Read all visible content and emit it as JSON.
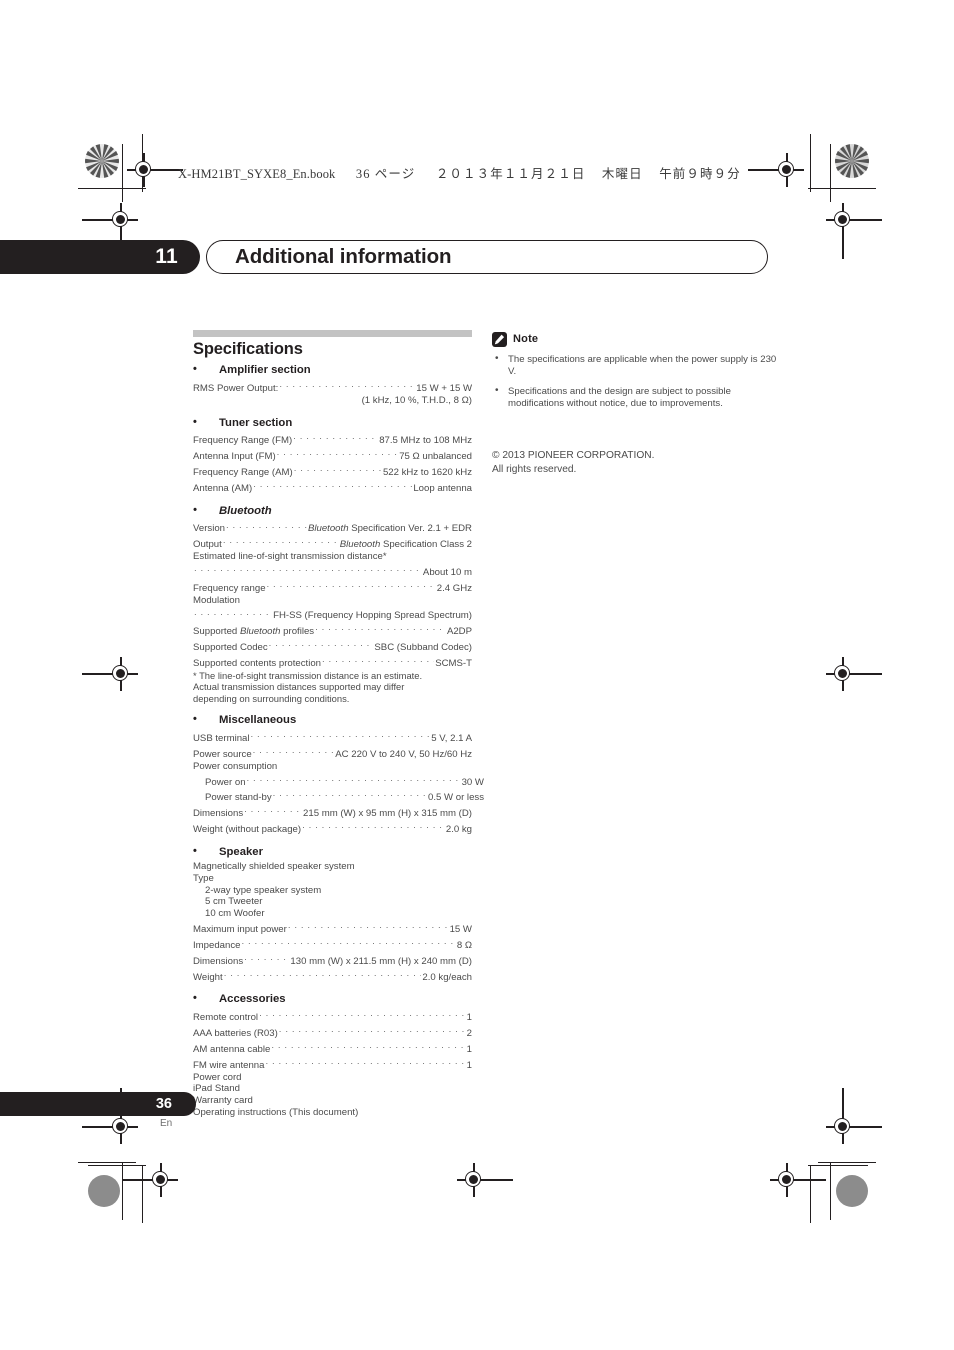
{
  "running_header": {
    "filename": "X-HM21BT_SYXE8_En.book",
    "page_label": "36 ページ",
    "date": "２０１３年１１月２１日",
    "weekday": "木曜日",
    "time": "午前９時９分"
  },
  "chapter": {
    "number": "11",
    "title": "Additional information"
  },
  "specifications": {
    "heading": "Specifications",
    "sections": [
      {
        "name": "Amplifier section",
        "rows": [
          {
            "label": "RMS Power Output:",
            "value": "15 W + 15 W",
            "leader": true
          },
          {
            "label": "(1 kHz, 10 %, T.H.D., 8 Ω)",
            "align": "right"
          }
        ]
      },
      {
        "name": "Tuner section",
        "rows": [
          {
            "label": "Frequency Range (FM)",
            "value": "87.5 MHz to 108 MHz",
            "leader": true
          },
          {
            "label": "Antenna Input (FM)",
            "value": "75 Ω unbalanced",
            "leader": true
          },
          {
            "label": "Frequency Range (AM)",
            "value": "522 kHz to 1620 kHz",
            "leader": true
          },
          {
            "label": "Antenna (AM)",
            "value": "Loop antenna",
            "leader": true
          }
        ]
      },
      {
        "name": "Bluetooth",
        "italic": true,
        "rows": [
          {
            "label": "Version",
            "value": "Bluetooth Specification Ver. 2.1 + EDR",
            "leader": true,
            "value_italic_prefix": "Bluetooth"
          },
          {
            "label": "Output",
            "value": "Bluetooth Specification Class 2",
            "leader": true,
            "value_italic_prefix": "Bluetooth"
          },
          {
            "label": "Estimated line-of-sight transmission distance*"
          },
          {
            "label": "",
            "value": "About 10 m",
            "leader": true
          },
          {
            "label": "Frequency range",
            "value": "2.4 GHz",
            "leader": true
          },
          {
            "label": "Modulation"
          },
          {
            "label": "",
            "value": "FH-SS (Frequency Hopping Spread Spectrum)",
            "leader": true
          },
          {
            "label": "Supported Bluetooth profiles",
            "value": "A2DP",
            "leader": true,
            "label_italic_word": "Bluetooth"
          },
          {
            "label": "Supported Codec",
            "value": "SBC (Subband Codec)",
            "leader": true
          },
          {
            "label": "Supported contents protection",
            "value": "SCMS-T",
            "leader": true
          },
          {
            "label": "* The line-of-sight transmission distance is an estimate."
          },
          {
            "label": "Actual transmission distances supported may differ"
          },
          {
            "label": "depending on surrounding conditions."
          }
        ]
      },
      {
        "name": "Miscellaneous",
        "rows": [
          {
            "label": "USB terminal",
            "value": "5 V, 2.1 A",
            "leader": true
          },
          {
            "label": "Power source",
            "value": "AC 220 V to 240 V, 50 Hz/60 Hz",
            "leader": true
          },
          {
            "label": "Power consumption"
          },
          {
            "label": "Power on",
            "value": "30 W",
            "leader": true,
            "indent": true
          },
          {
            "label": "Power stand-by",
            "value": "0.5 W or less",
            "leader": true,
            "indent": true
          },
          {
            "label": "Dimensions",
            "value": "215 mm (W) x 95 mm (H) x 315 mm (D)",
            "leader": true
          },
          {
            "label": "Weight (without package)",
            "value": "2.0 kg",
            "leader": true
          }
        ]
      },
      {
        "name": "Speaker",
        "rows": [
          {
            "label": "Magnetically shielded speaker system"
          },
          {
            "label": "Type"
          },
          {
            "label": "2-way type speaker system",
            "indent": true
          },
          {
            "label": "5 cm Tweeter",
            "indent": true
          },
          {
            "label": "10 cm Woofer",
            "indent": true
          },
          {
            "label": "Maximum input power",
            "value": "15 W",
            "leader": true
          },
          {
            "label": "Impedance",
            "value": "8 Ω",
            "leader": true
          },
          {
            "label": "Dimensions",
            "value": "130 mm (W) x 211.5 mm (H) x 240 mm (D)",
            "leader": true
          },
          {
            "label": "Weight",
            "value": "2.0 kg/each",
            "leader": true
          }
        ]
      },
      {
        "name": "Accessories",
        "rows": [
          {
            "label": "Remote control",
            "value": "1",
            "leader": true
          },
          {
            "label": "AAA batteries (R03)",
            "value": "2",
            "leader": true
          },
          {
            "label": "AM antenna cable",
            "value": "1",
            "leader": true
          },
          {
            "label": "FM wire antenna",
            "value": "1",
            "leader": true
          },
          {
            "label": "Power cord"
          },
          {
            "label": "iPad Stand"
          },
          {
            "label": "Warranty card"
          },
          {
            "label": "Operating instructions (This document)"
          }
        ]
      }
    ]
  },
  "note": {
    "label": "Note",
    "items": [
      "The specifications are applicable when the power supply is 230 V.",
      "Specifications and the design are subject to possible modifications without notice, due to improvements."
    ]
  },
  "copyright": {
    "line1": "© 2013 PIONEER CORPORATION.",
    "line2": "All rights reserved."
  },
  "footer": {
    "page_number": "36",
    "language": "En"
  },
  "colors": {
    "ink": "#231f20",
    "body_text": "#4b4b4b",
    "rule": "#c3c3c3"
  }
}
